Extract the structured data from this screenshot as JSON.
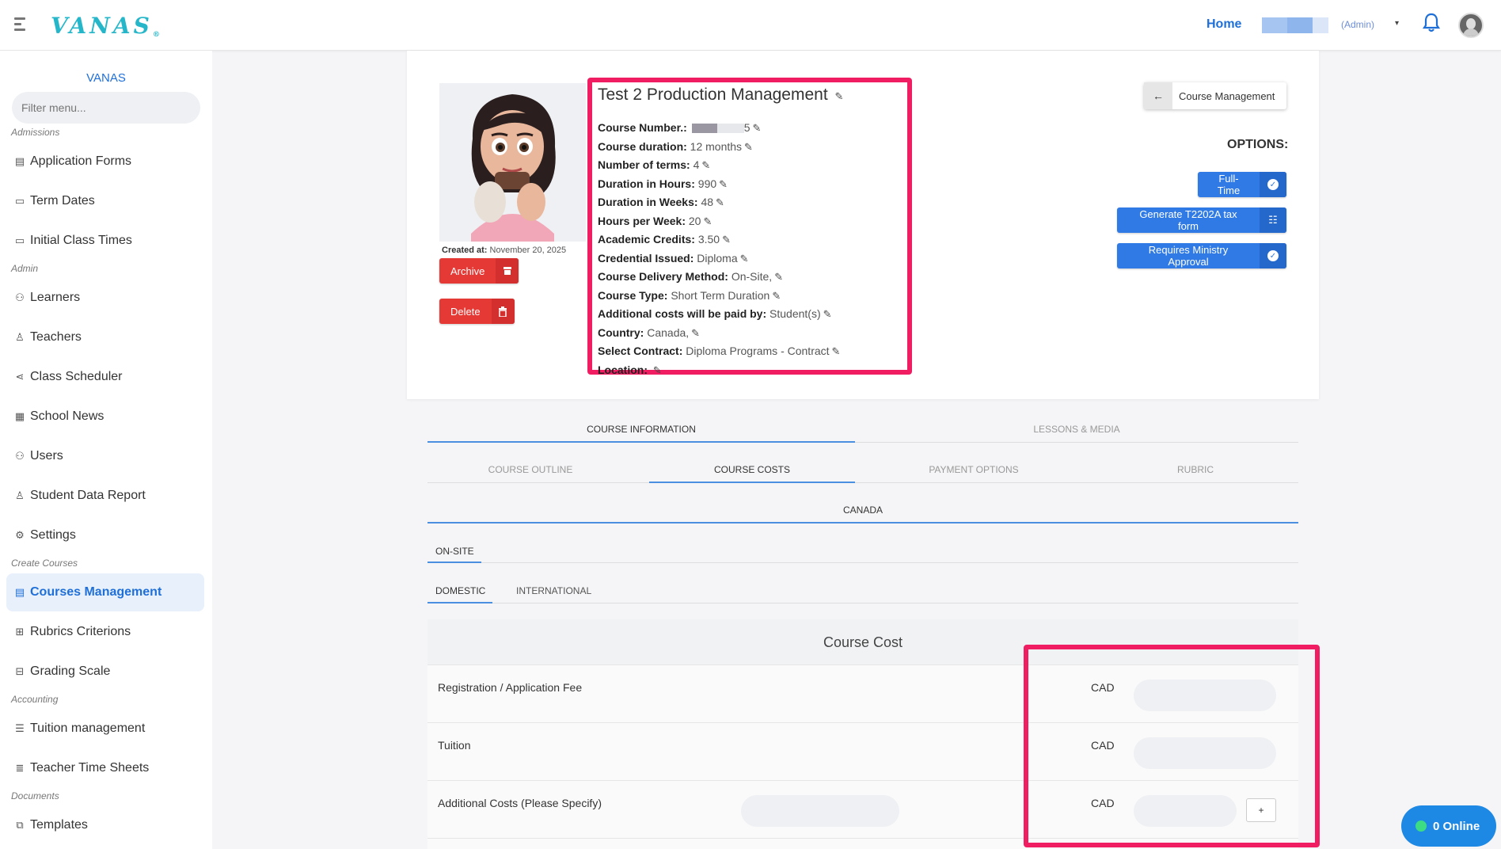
{
  "topbar": {
    "logo": "VANAS",
    "logo_mark": "®",
    "home_label": "Home",
    "user_role": "(Admin)",
    "caret": "▾"
  },
  "sidebar": {
    "title": "VANAS",
    "filter_placeholder": "Filter menu...",
    "sections": {
      "admissions": "Admissions",
      "admin": "Admin",
      "create_courses": "Create Courses",
      "accounting": "Accounting",
      "documents": "Documents"
    },
    "items": [
      {
        "label": "Application Forms",
        "icon": "document-icon"
      },
      {
        "label": "Term Dates",
        "icon": "calendar-icon"
      },
      {
        "label": "Initial Class Times",
        "icon": "calendar-icon"
      },
      {
        "label": "Learners",
        "icon": "users-icon"
      },
      {
        "label": "Teachers",
        "icon": "user-icon"
      },
      {
        "label": "Class Scheduler",
        "icon": "share-icon"
      },
      {
        "label": "School News",
        "icon": "newspaper-icon"
      },
      {
        "label": "Users",
        "icon": "users-icon"
      },
      {
        "label": "Student Data Report",
        "icon": "user-icon"
      },
      {
        "label": "Settings",
        "icon": "gear-icon"
      },
      {
        "label": "Courses Management",
        "icon": "document-icon",
        "active": true
      },
      {
        "label": "Rubrics Criterions",
        "icon": "grid-icon"
      },
      {
        "label": "Grading Scale",
        "icon": "table-icon"
      },
      {
        "label": "Tuition management",
        "icon": "list-icon"
      },
      {
        "label": "Teacher Time Sheets",
        "icon": "timesheet-icon"
      },
      {
        "label": "Templates",
        "icon": "copy-icon"
      }
    ]
  },
  "course": {
    "created_label": "Created at:",
    "created_date": "November 20, 2025",
    "archive_label": "Archive",
    "delete_label": "Delete",
    "title": "Test 2 Production Management",
    "details": {
      "course_number_label": "Course Number.:",
      "course_number_tail": "5",
      "duration_label": "Course duration:",
      "duration_value": "12 months",
      "terms_label": "Number of terms:",
      "terms_value": "4",
      "hours_label": "Duration in Hours:",
      "hours_value": "990",
      "weeks_label": "Duration in Weeks:",
      "weeks_value": "48",
      "hpw_label": "Hours per Week:",
      "hpw_value": "20",
      "credits_label": "Academic Credits:",
      "credits_value": "3.50",
      "credential_label": "Credential Issued:",
      "credential_value": "Diploma",
      "delivery_label": "Course Delivery Method:",
      "delivery_value": "On-Site,",
      "type_label": "Course Type:",
      "type_value": "Short Term Duration",
      "addl_label": "Additional costs will be paid by:",
      "addl_value": "Student(s)",
      "country_label": "Country:",
      "country_value": "Canada,",
      "contract_label": "Select Contract:",
      "contract_value": "Diploma Programs - Contract",
      "location_label": "Location:"
    },
    "back_label": "Course Management",
    "options_label": "OPTIONS:",
    "option_buttons": [
      "Full-Time",
      "Generate T2202A tax form",
      "Requires Ministry Approval"
    ]
  },
  "tabs": {
    "main": [
      "COURSE INFORMATION",
      "LESSONS & MEDIA"
    ],
    "sub": [
      "COURSE OUTLINE",
      "COURSE COSTS",
      "PAYMENT OPTIONS",
      "RUBRIC"
    ],
    "country": "CANADA",
    "delivery": "ON-SITE",
    "residency": [
      "DOMESTIC",
      "INTERNATIONAL"
    ]
  },
  "costs": {
    "header": "Course Cost",
    "rows": [
      {
        "label": "Registration / Application Fee",
        "currency": "CAD"
      },
      {
        "label": "Tuition",
        "currency": "CAD"
      },
      {
        "label": "Additional Costs (Please Specify)",
        "currency": "CAD"
      }
    ],
    "add_label": "+"
  },
  "online": {
    "label": "0 Online"
  },
  "colors": {
    "accent": "#1f6fd8",
    "highlight": "#f01d62",
    "danger": "#e53935",
    "primary_button": "#2f7ae5"
  }
}
